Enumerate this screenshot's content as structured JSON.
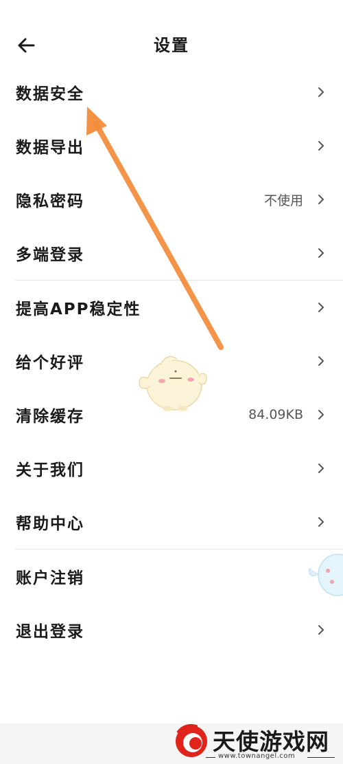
{
  "header": {
    "title": "设置",
    "back_icon": "arrow-left-icon"
  },
  "groups": [
    {
      "items": [
        {
          "label": "数据安全",
          "value": ""
        },
        {
          "label": "数据导出",
          "value": ""
        },
        {
          "label": "隐私密码",
          "value": "不使用"
        },
        {
          "label": "多端登录",
          "value": ""
        }
      ]
    },
    {
      "items": [
        {
          "label": "提高APP稳定性",
          "value": ""
        },
        {
          "label": "给个好评",
          "value": ""
        },
        {
          "label": "清除缓存",
          "value": "84.09KB"
        },
        {
          "label": "关于我们",
          "value": ""
        },
        {
          "label": "帮助中心",
          "value": ""
        }
      ]
    },
    {
      "items": [
        {
          "label": "账户注销",
          "value": ""
        },
        {
          "label": "退出登录",
          "value": ""
        }
      ]
    }
  ],
  "annotation": {
    "arrow_color": "#F28C3A",
    "points_to": "数据安全"
  },
  "watermark": {
    "brand": "天使游戏网",
    "url": "www.townangel.com",
    "logo_color": "#E0231B"
  }
}
